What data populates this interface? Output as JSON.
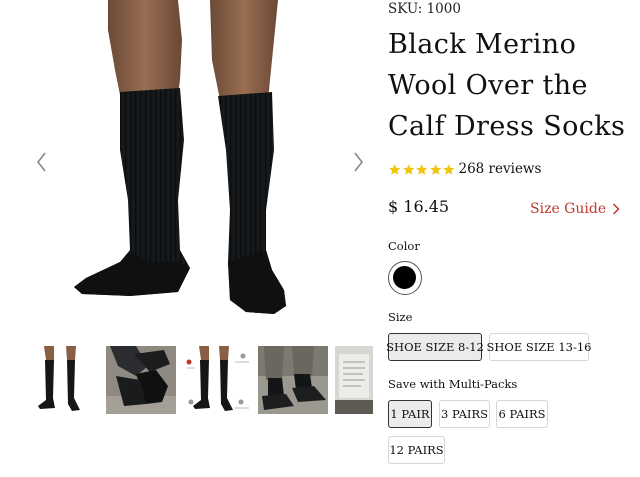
{
  "product": {
    "sku": "SKU: 1000",
    "title": "Black Merino Wool Over the Calf Dress Socks",
    "rating": 5,
    "reviews_label": "268 reviews",
    "price": "$ 16.45",
    "size_guide_label": "Size Guide"
  },
  "options": {
    "color_label": "Color",
    "color_swatch": "#000000",
    "size_label": "Size",
    "sizes": [
      "SHOE SIZE 8-12",
      "SHOE SIZE 13-16"
    ],
    "selected_size": "SHOE SIZE 8-12",
    "multipack_label": "Save with Multi-Packs",
    "packs": [
      "1 PAIR",
      "3 PAIRS",
      "6 PAIRS",
      "12 PAIRS"
    ],
    "selected_pack": "1 PAIR"
  },
  "gallery": {
    "prev_icon": "chevron-left-icon",
    "next_icon": "chevron-right-icon",
    "thumbnails": [
      "legs-front",
      "dress-shoes-crossed",
      "sock-features-diagram",
      "trousers-and-shoes",
      "packaging-label"
    ]
  },
  "colors": {
    "accent": "#c0392b",
    "star": "#f1c40f",
    "selected_bg": "#ebebeb"
  }
}
